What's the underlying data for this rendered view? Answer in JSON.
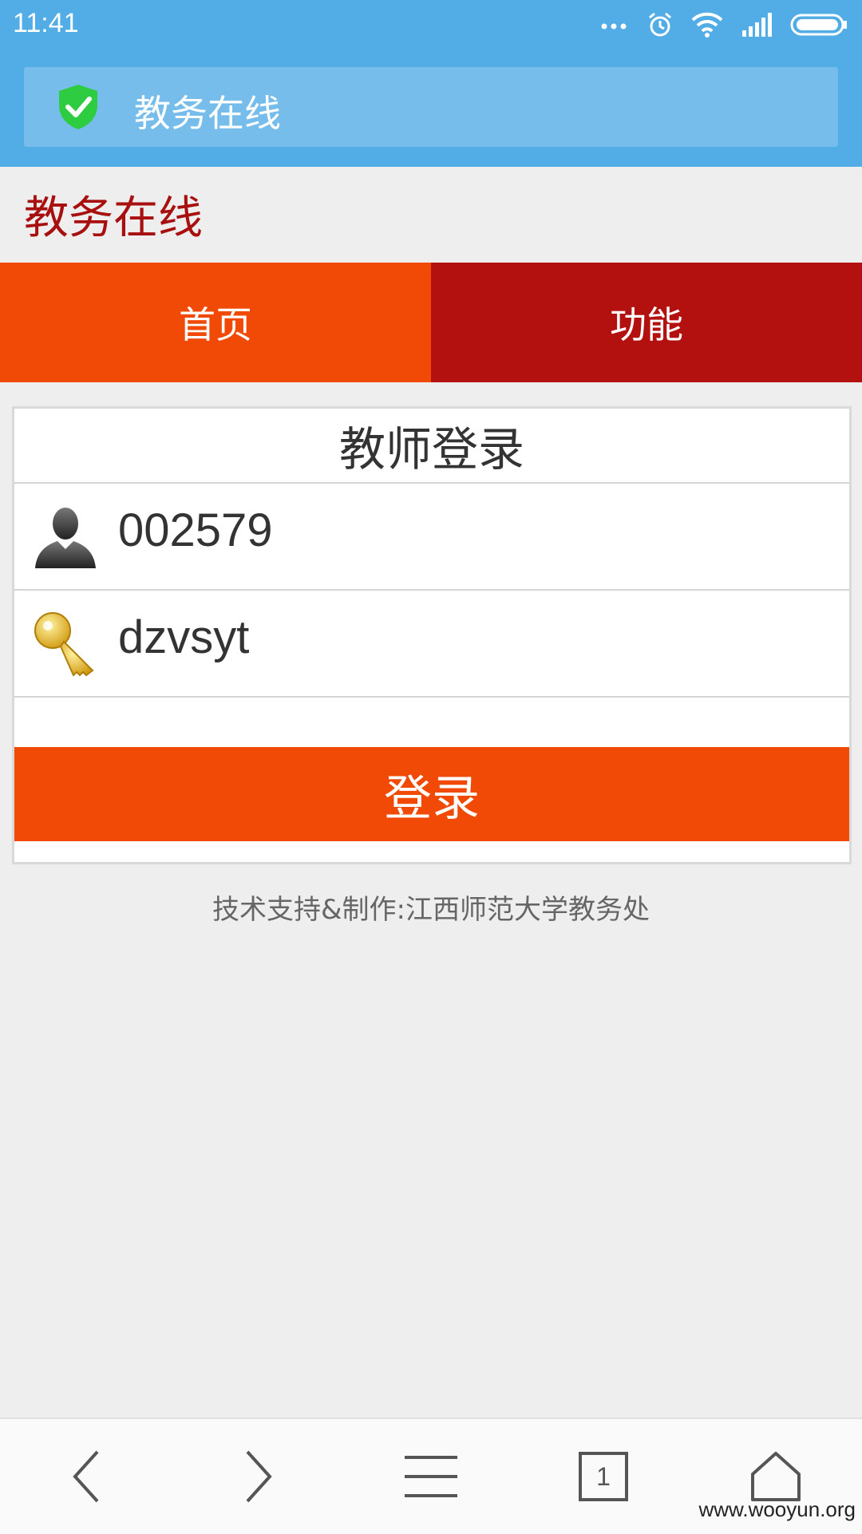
{
  "status_bar": {
    "time": "11:41",
    "icons": [
      "more-dots-icon",
      "alarm-icon",
      "wifi-icon",
      "signal-icon",
      "battery-icon"
    ]
  },
  "url_bar": {
    "title": "教务在线",
    "security_icon": "shield-check-icon",
    "security_color": "#2ecc40"
  },
  "site": {
    "title": "教务在线",
    "title_color": "#a80f0f"
  },
  "nav": {
    "tabs": [
      {
        "label": "首页",
        "color": "#f04a06"
      },
      {
        "label": "功能",
        "color": "#b31010"
      }
    ]
  },
  "login": {
    "heading": "教师登录",
    "username": "002579",
    "password": "dzvsyt",
    "username_icon": "user-silhouette-icon",
    "password_icon": "key-icon",
    "submit_label": "登录",
    "accent": "#f04a06"
  },
  "footer": {
    "credit": "技术支持&制作:江西师范大学教务处"
  },
  "bottom_bar": {
    "buttons": [
      "back-icon",
      "forward-icon",
      "menu-icon",
      "tabs-icon",
      "home-icon"
    ],
    "tab_count": "1"
  },
  "watermark": "www.wooyun.org"
}
